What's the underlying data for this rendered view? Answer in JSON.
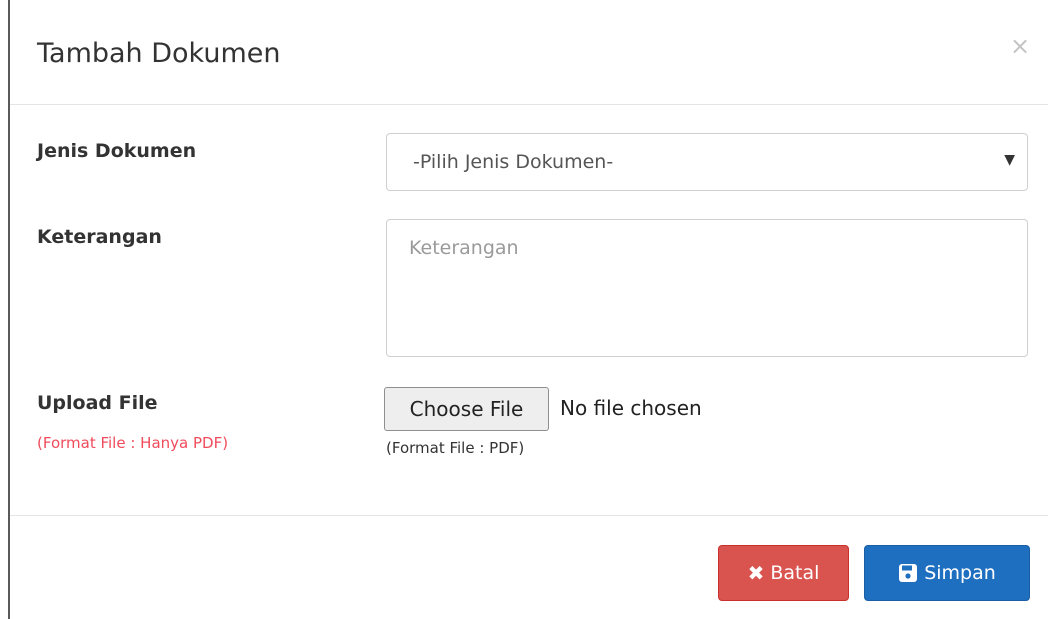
{
  "modal": {
    "title": "Tambah Dokumen",
    "close_glyph": "×"
  },
  "form": {
    "jenis_label": "Jenis Dokumen",
    "jenis_selected": "-Pilih Jenis Dokumen-",
    "keterangan_label": "Keterangan",
    "keterangan_placeholder": "Keterangan",
    "upload_label": "Upload File",
    "upload_note": "(Format File : Hanya PDF)",
    "choose_file_label": "Choose File",
    "file_status": "No file chosen",
    "format_hint": "(Format File : PDF)"
  },
  "footer": {
    "cancel_label": "Batal",
    "save_label": "Simpan"
  },
  "icons": {
    "close": "close-icon",
    "select_arrow": "caret-down-icon",
    "cancel": "x-icon",
    "save": "save-icon"
  },
  "colors": {
    "cancel_bg": "#d9534f",
    "save_bg": "#1f6fc0",
    "note_red": "#f04b5b"
  }
}
